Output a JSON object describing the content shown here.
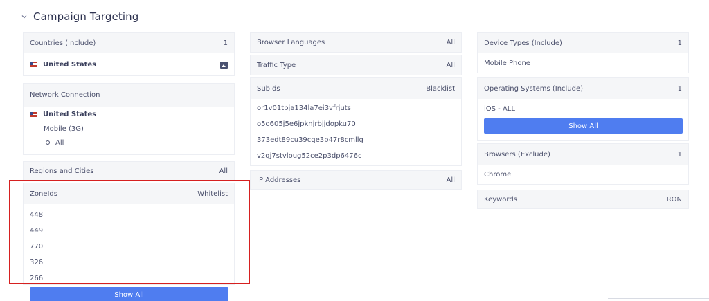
{
  "section": {
    "title": "Campaign Targeting"
  },
  "countries": {
    "label": "Countries (Include)",
    "count": "1",
    "value": "United States"
  },
  "network": {
    "label": "Network Connection",
    "country": "United States",
    "type": "Mobile (3G)",
    "option": "All"
  },
  "regions": {
    "label": "Regions and Cities",
    "value": "All"
  },
  "zoneids": {
    "label": "ZoneIds",
    "mode": "Whitelist",
    "items": [
      "448",
      "449",
      "770",
      "326",
      "266"
    ],
    "button": "Show All"
  },
  "browser_languages": {
    "label": "Browser Languages",
    "value": "All"
  },
  "traffic_type": {
    "label": "Traffic Type",
    "value": "All"
  },
  "subids": {
    "label": "SubIds",
    "mode": "Blacklist",
    "items": [
      "or1v01tbja134la7ei3vfrjuts",
      "o5o605j5e6jpknjrbjjdopku70",
      "373edt89cu39cqe3p47r8cmllg",
      "v2qj7stvloug52ce2p3dp6476c"
    ]
  },
  "ip_addresses": {
    "label": "IP Addresses",
    "value": "All"
  },
  "device_types": {
    "label": "Device Types (Include)",
    "count": "1",
    "value": "Mobile Phone"
  },
  "operating_systems": {
    "label": "Operating Systems (Include)",
    "count": "1",
    "value": "iOS - ALL",
    "button": "Show All"
  },
  "browsers": {
    "label": "Browsers (Exclude)",
    "count": "1",
    "value": "Chrome"
  },
  "keywords": {
    "label": "Keywords",
    "value": "RON"
  },
  "colors": {
    "button_bg": "#4f7df0",
    "highlight_border": "#d62020",
    "header_bg": "#f5f6f8"
  }
}
